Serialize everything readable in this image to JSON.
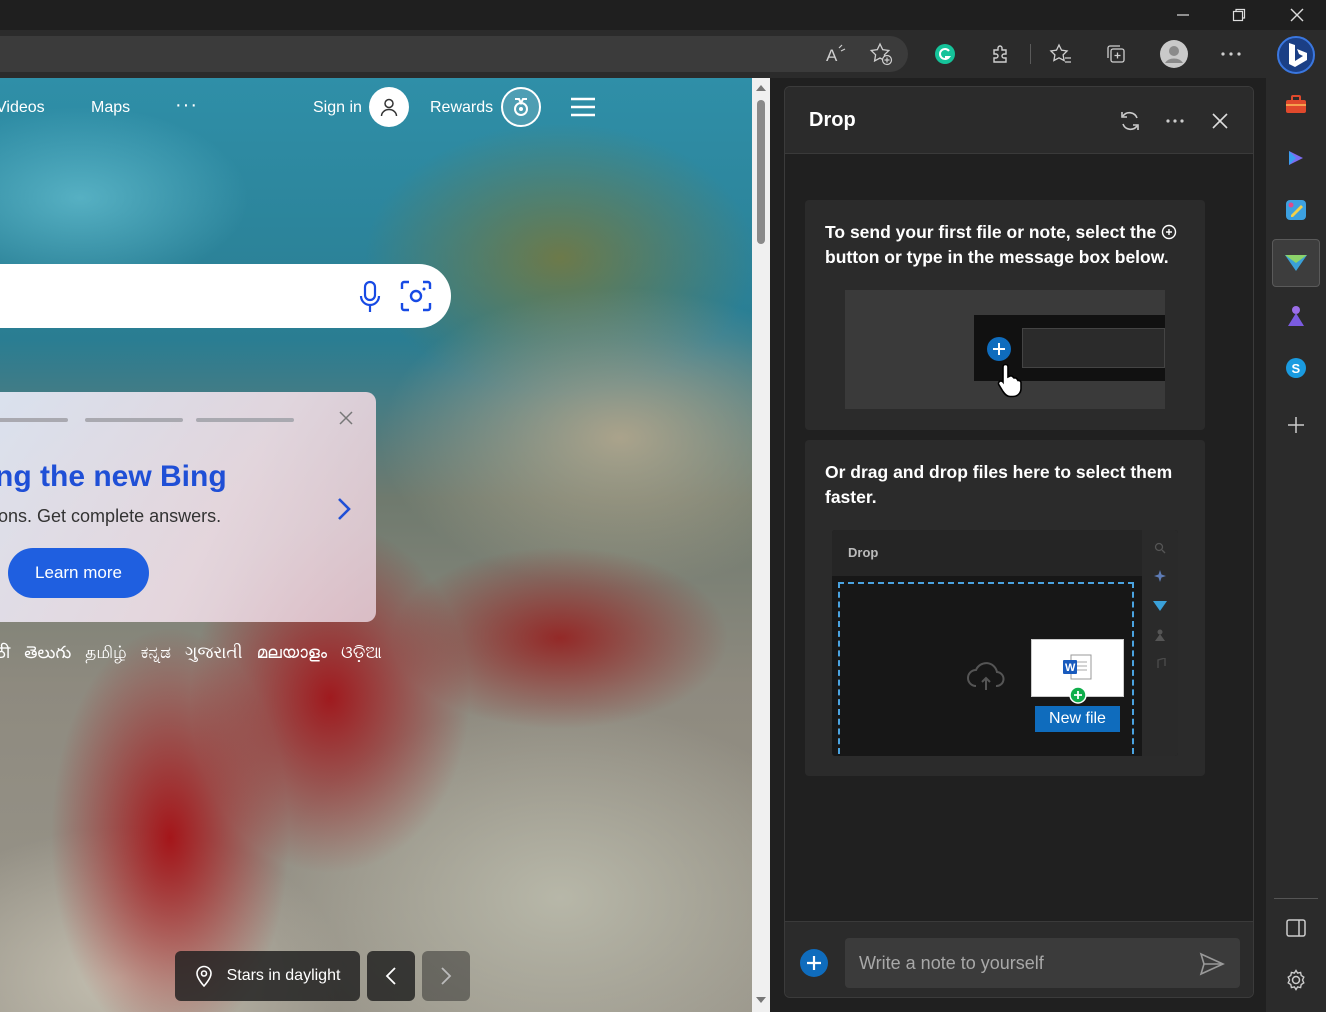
{
  "page": {
    "nav": {
      "videos": "Videos",
      "maps": "Maps",
      "more": "···",
      "sign_in": "Sign in",
      "rewards": "Rewards"
    },
    "promo": {
      "title": "cing the new Bing",
      "subtitle": "estions. Get complete answers.",
      "learn_more": "Learn more"
    },
    "languages": [
      "ठी",
      "తెలుగు",
      "தமிழ்",
      "ಕನ್ನಡ",
      "ગુજરાતી",
      "മലയാളം",
      "ଓଡ଼ିଆ"
    ],
    "image_caption": "Stars in daylight"
  },
  "drop": {
    "title": "Drop",
    "card1_text_a": "To send your first file or note, select the",
    "card1_text_b": "button or type in the message box below.",
    "card2_text": "Or drag and drop files here to select them faster.",
    "mini_title": "Drop",
    "new_file": "New file",
    "note_placeholder": "Write a note to yourself"
  },
  "colors": {
    "accent": "#0f6cbd",
    "bing_blue": "#1f5fe0",
    "grammarly": "#15c39a"
  }
}
